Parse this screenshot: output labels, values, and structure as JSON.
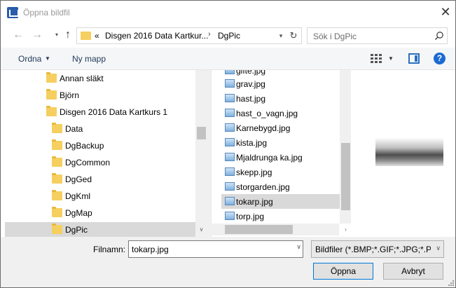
{
  "window": {
    "title": "Öppna bildfil"
  },
  "nav": {
    "back": "←",
    "forward": "→",
    "up": "↑",
    "address_prefix": "«",
    "path": [
      "Disgen 2016 Data Kartkur...",
      "DgPic"
    ],
    "refresh": "↻",
    "search_placeholder": "Sök i DgPic"
  },
  "toolbar": {
    "organize": "Ordna",
    "new_folder": "Ny mapp",
    "help": "?"
  },
  "tree": [
    {
      "label": "Annan släkt",
      "level": 1,
      "selected": false
    },
    {
      "label": "Björn",
      "level": 1,
      "selected": false
    },
    {
      "label": "Disgen 2016 Data Kartkurs 1",
      "level": 1,
      "selected": false
    },
    {
      "label": "Data",
      "level": 2,
      "selected": false
    },
    {
      "label": "DgBackup",
      "level": 2,
      "selected": false
    },
    {
      "label": "DgCommon",
      "level": 2,
      "selected": false
    },
    {
      "label": "DgGed",
      "level": 2,
      "selected": false
    },
    {
      "label": "DgKml",
      "level": 2,
      "selected": false
    },
    {
      "label": "DgMap",
      "level": 2,
      "selected": false
    },
    {
      "label": "DgPic",
      "level": 2,
      "selected": true
    }
  ],
  "files": [
    {
      "name": "gifte.jpg",
      "selected": false
    },
    {
      "name": "grav.jpg",
      "selected": false
    },
    {
      "name": "hast.jpg",
      "selected": false
    },
    {
      "name": "hast_o_vagn.jpg",
      "selected": false
    },
    {
      "name": "Karnebygd.jpg",
      "selected": false
    },
    {
      "name": "kista.jpg",
      "selected": false
    },
    {
      "name": "Mjaldrunga ka.jpg",
      "selected": false
    },
    {
      "name": "skepp.jpg",
      "selected": false
    },
    {
      "name": "storgarden.jpg",
      "selected": false
    },
    {
      "name": "tokarp.jpg",
      "selected": true
    },
    {
      "name": "torp.jpg",
      "selected": false
    }
  ],
  "bottom": {
    "filename_label": "Filnamn:",
    "filename_value": "tokarp.jpg",
    "filter": "Bildfiler (*.BMP;*.GIF;*.JPG;*.PC",
    "open": "Öppna",
    "cancel": "Avbryt"
  }
}
